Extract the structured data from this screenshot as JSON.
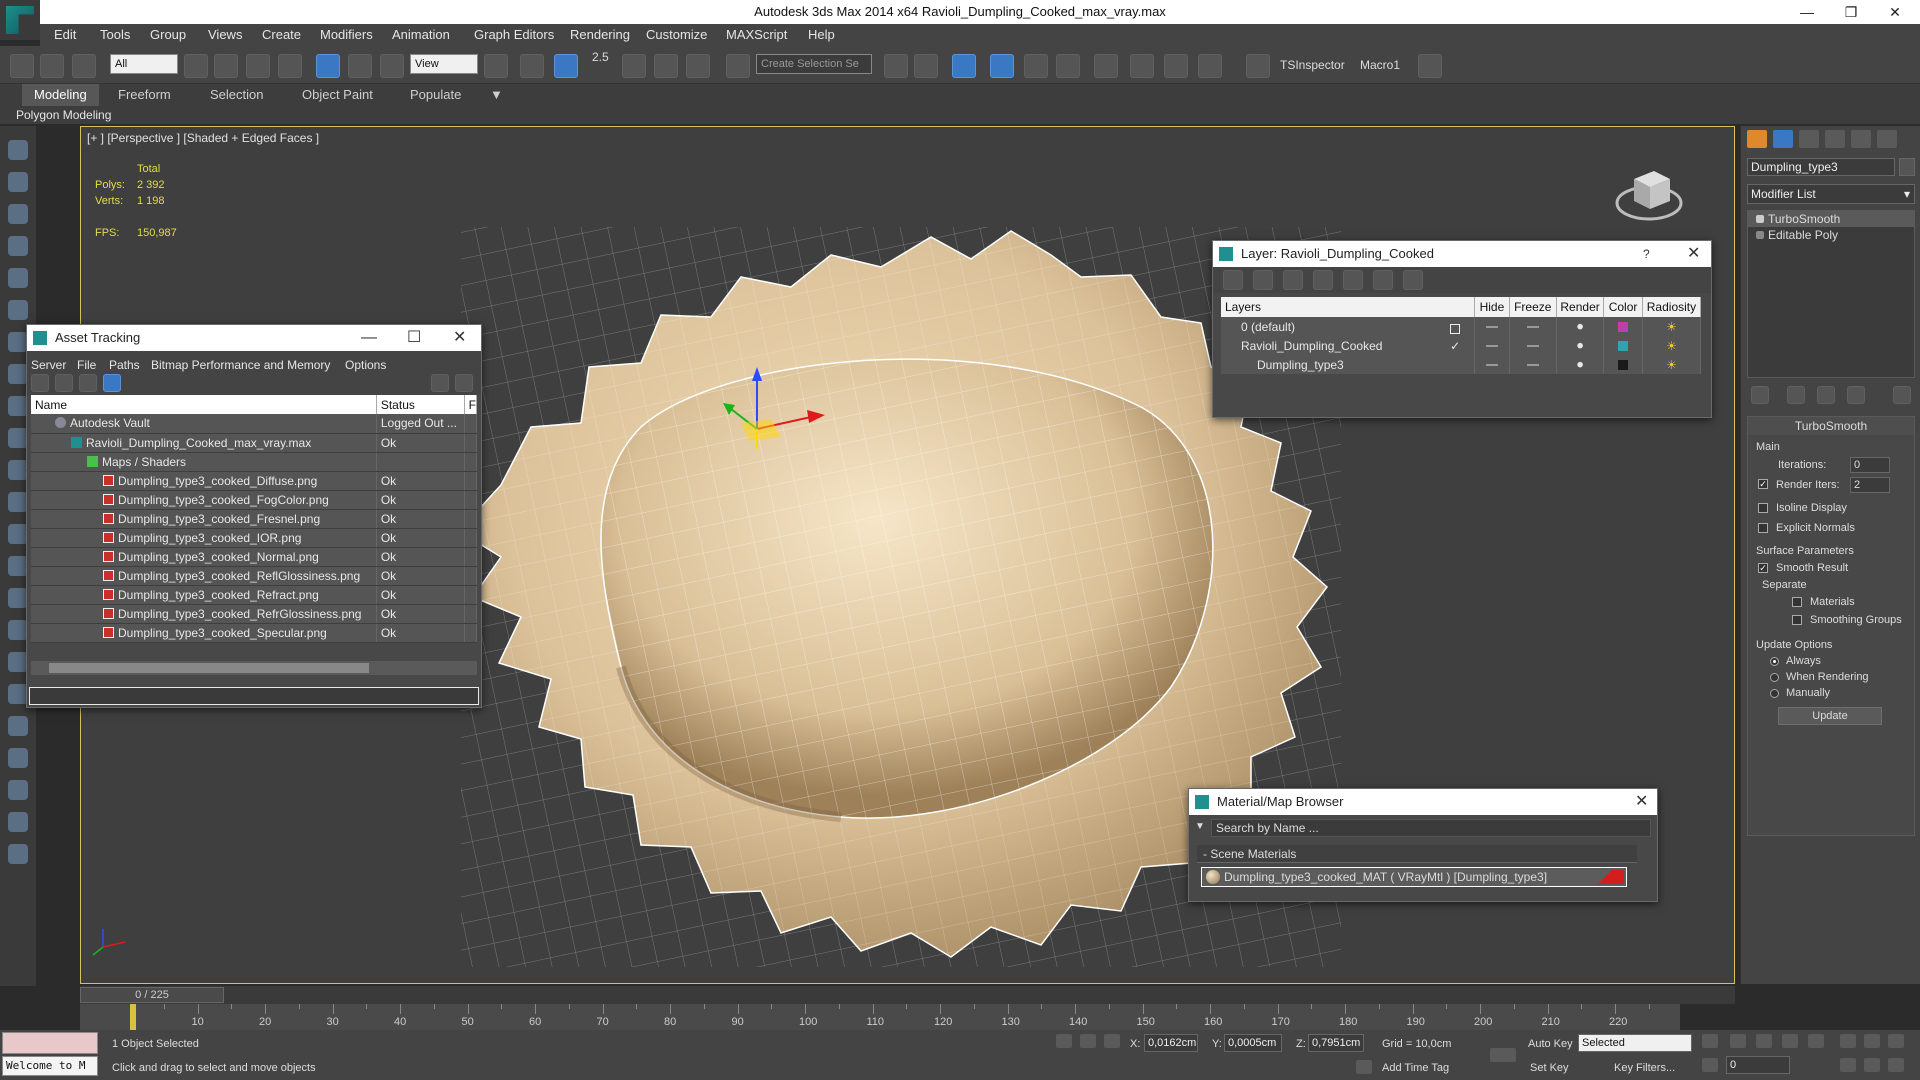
{
  "window": {
    "title": "Autodesk 3ds Max  2014 x64    Ravioli_Dumpling_Cooked_max_vray.max"
  },
  "menu": [
    "Edit",
    "Tools",
    "Group",
    "Views",
    "Create",
    "Modifiers",
    "Animation",
    "Graph Editors",
    "Rendering",
    "Customize",
    "MAXScript",
    "Help"
  ],
  "toolbar": {
    "filter_select": "All",
    "ref_coord_select": "View",
    "snap_value": "2.5",
    "selection_set": "Create Selection Se",
    "tsinspector": "TSInspector",
    "macro": "Macro1"
  },
  "ribbon": {
    "tabs": [
      "Modeling",
      "Freeform",
      "Selection",
      "Object Paint",
      "Populate"
    ],
    "active_tab": "Modeling",
    "sub_label": "Polygon Modeling"
  },
  "viewport": {
    "label": "[+ ] [Perspective ] [Shaded + Edged Faces ]",
    "stats_header": "Total",
    "polys_label": "Polys:",
    "polys_value": "2 392",
    "verts_label": "Verts:",
    "verts_value": "1 198",
    "fps_label": "FPS:",
    "fps_value": "150,987"
  },
  "asset_tracking": {
    "title": "Asset Tracking",
    "menu": [
      "Server",
      "File",
      "Paths",
      "Bitmap Performance and Memory",
      "Options"
    ],
    "columns": [
      "Name",
      "Status",
      "F"
    ],
    "rows": [
      {
        "name": "Autodesk Vault",
        "status": "Logged Out ...",
        "icon": "vault-icon"
      },
      {
        "name": "Ravioli_Dumpling_Cooked_max_vray.max",
        "status": "Ok",
        "icon": "max-file-icon"
      },
      {
        "name": "Maps / Shaders",
        "status": "",
        "icon": "folder-icon"
      },
      {
        "name": "Dumpling_type3_cooked_Diffuse.png",
        "status": "Ok",
        "icon": "bitmap-icon"
      },
      {
        "name": "Dumpling_type3_cooked_FogColor.png",
        "status": "Ok",
        "icon": "bitmap-icon"
      },
      {
        "name": "Dumpling_type3_cooked_Fresnel.png",
        "status": "Ok",
        "icon": "bitmap-icon"
      },
      {
        "name": "Dumpling_type3_cooked_IOR.png",
        "status": "Ok",
        "icon": "bitmap-icon"
      },
      {
        "name": "Dumpling_type3_cooked_Normal.png",
        "status": "Ok",
        "icon": "bitmap-icon"
      },
      {
        "name": "Dumpling_type3_cooked_ReflGlossiness.png",
        "status": "Ok",
        "icon": "bitmap-icon"
      },
      {
        "name": "Dumpling_type3_cooked_Refract.png",
        "status": "Ok",
        "icon": "bitmap-icon"
      },
      {
        "name": "Dumpling_type3_cooked_RefrGlossiness.png",
        "status": "Ok",
        "icon": "bitmap-icon"
      },
      {
        "name": "Dumpling_type3_cooked_Specular.png",
        "status": "Ok",
        "icon": "bitmap-icon"
      }
    ]
  },
  "layer_window": {
    "title": "Layer: Ravioli_Dumpling_Cooked",
    "help": "?",
    "columns": [
      "Layers",
      "Hide",
      "Freeze",
      "Render",
      "Color",
      "Radiosity"
    ],
    "rows": [
      {
        "name": "0 (default)",
        "color": "#c23bb0",
        "current": false
      },
      {
        "name": "Ravioli_Dumpling_Cooked",
        "color": "#2fa3b5",
        "current": true
      },
      {
        "name": "Dumpling_type3",
        "color": "#1a1a1a",
        "current": false
      }
    ]
  },
  "material_browser": {
    "title": "Material/Map Browser",
    "search_placeholder": "Search by Name ...",
    "group": "- Scene Materials",
    "material": "Dumpling_type3_cooked_MAT ( VRayMtl ) [Dumpling_type3]"
  },
  "command_panel": {
    "object_name": "Dumpling_type3",
    "modifier_list": "Modifier List",
    "stack": [
      "TurboSmooth",
      "Editable Poly"
    ],
    "turbosmooth": {
      "title": "TurboSmooth",
      "main": "Main",
      "iterations_label": "Iterations:",
      "iterations": "0",
      "render_iters_label": "Render Iters:",
      "render_iters": "2",
      "isoline": "Isoline Display",
      "explicit_normals": "Explicit Normals",
      "surface_params": "Surface Parameters",
      "smooth_result": "Smooth Result",
      "separate": "Separate",
      "materials": "Materials",
      "smoothing_groups": "Smoothing Groups",
      "update_options": "Update Options",
      "always": "Always",
      "when_rendering": "When Rendering",
      "manually": "Manually",
      "update_button": "Update"
    }
  },
  "timeline": {
    "slider": "0 / 225",
    "ticks": [
      "10",
      "20",
      "30",
      "40",
      "50",
      "60",
      "70",
      "80",
      "90",
      "100",
      "110",
      "120",
      "130",
      "140",
      "150",
      "160",
      "170",
      "180",
      "190",
      "200",
      "210",
      "220"
    ]
  },
  "status": {
    "welcome": "Welcome to M",
    "selected": "1 Object Selected",
    "prompt": "Click and drag to select and move objects",
    "x_label": "X:",
    "x": "0,0162cm",
    "y_label": "Y:",
    "y": "0,0005cm",
    "z_label": "Z:",
    "z": "0,7951cm",
    "grid": "Grid = 10,0cm",
    "add_time_tag": "Add Time Tag",
    "auto_key": "Auto Key",
    "set_key": "Set Key",
    "key_mode": "Selected",
    "key_filters": "Key Filters...",
    "frame": "0"
  }
}
